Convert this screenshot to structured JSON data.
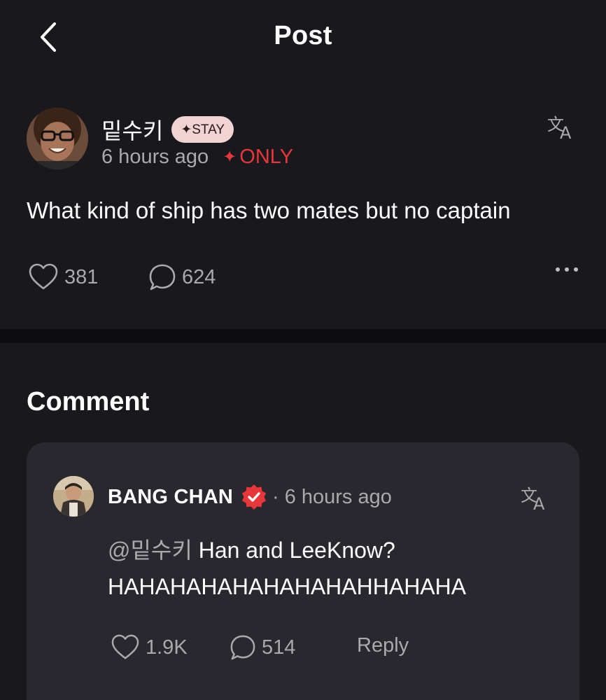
{
  "header": {
    "title": "Post",
    "back_icon": "chevron-left-icon"
  },
  "post": {
    "author": "밑수키",
    "badge": "✦STAY",
    "time": "6 hours ago",
    "only_label": "ONLY",
    "only_icon": "sparkle-icon",
    "text": "What kind of ship has two mates but no captain",
    "likes": "381",
    "comments": "624",
    "translate_icon": "translate-icon",
    "accent_color": "#e8363a"
  },
  "comments_section": {
    "title": "Comment",
    "items": [
      {
        "author": "BANG CHAN",
        "verified_icon": "verified-badge-icon",
        "separator": "·",
        "time": "6 hours ago",
        "mention": "@밑수키",
        "text_line1": "Han and LeeKnow?",
        "text_line2": "HAHAHAHAHAHAHAHAHHAHAHA",
        "likes": "1.9K",
        "replies": "514",
        "reply_label": "Reply"
      }
    ]
  }
}
